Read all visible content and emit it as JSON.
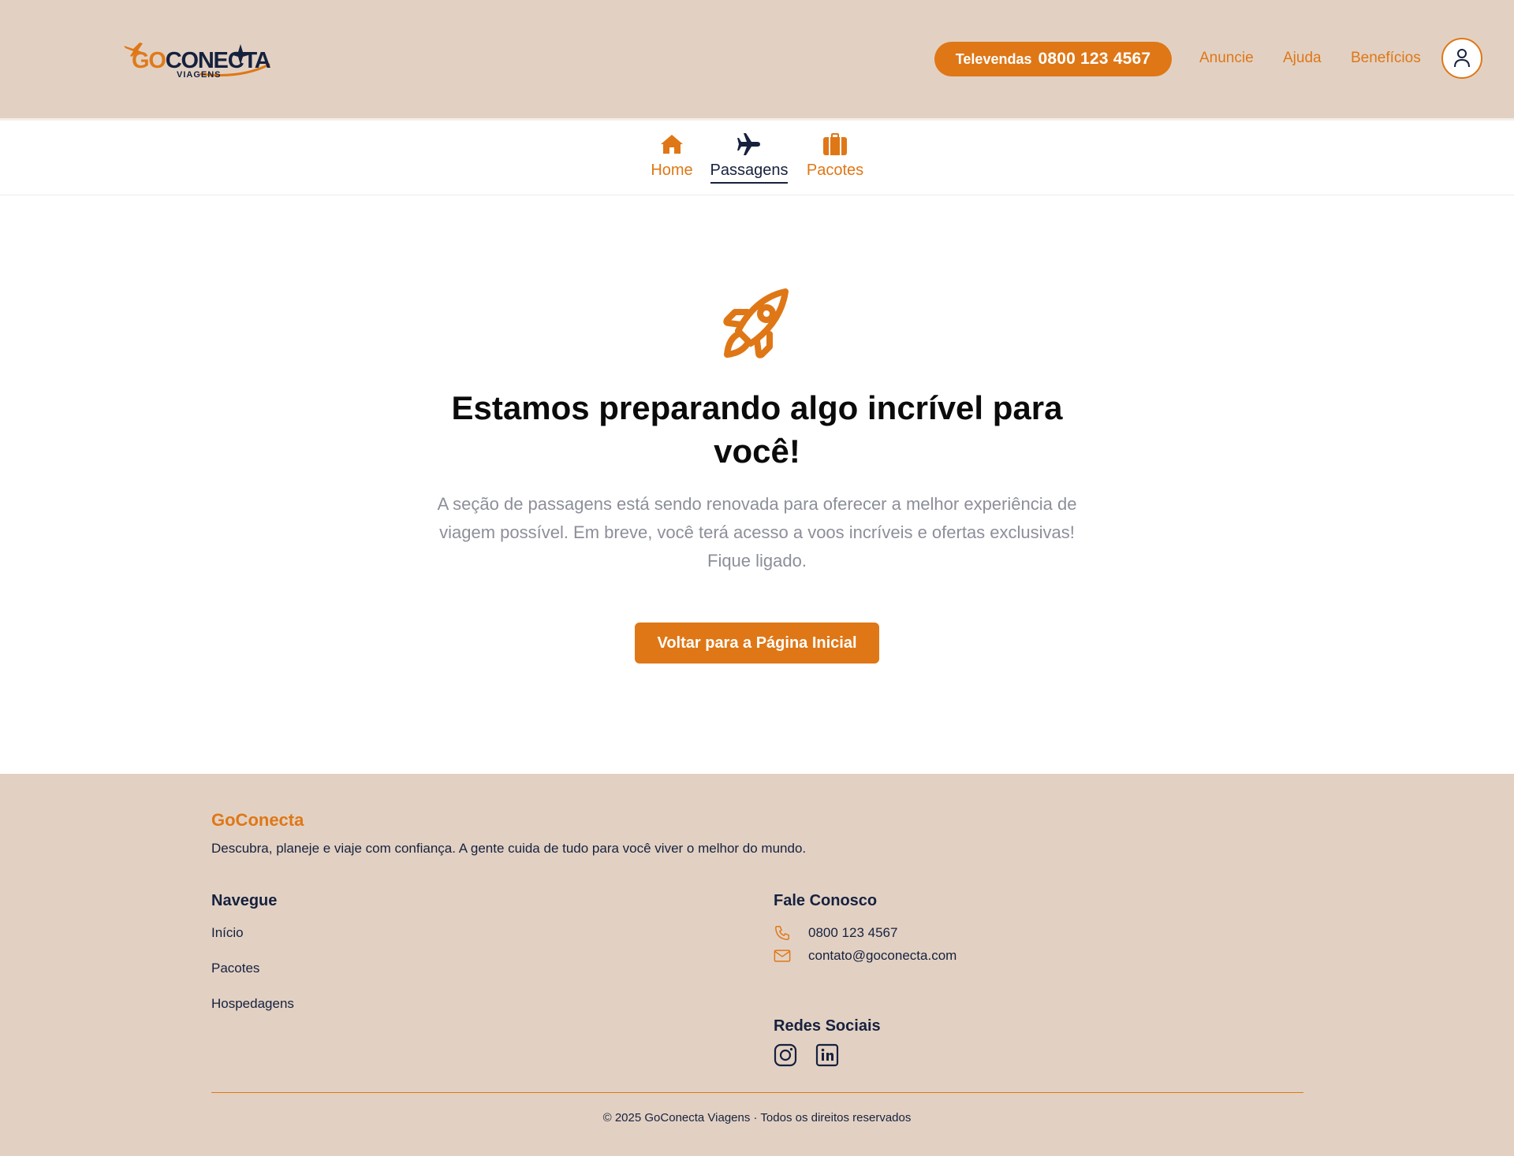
{
  "colors": {
    "accent": "#df7716",
    "navy": "#16213e",
    "header_bg": "#e2d1c3",
    "muted_text": "#8c8f99"
  },
  "header": {
    "logo": {
      "go": "GO",
      "conecta": "CONECTA",
      "sub": "VIAGENS"
    },
    "televendas_label": "Televendas",
    "televendas_number": "0800 123 4567",
    "links": [
      "Anuncie",
      "Ajuda",
      "Benefícios"
    ],
    "avatar_icon": "user-icon"
  },
  "tabs": [
    {
      "label": "Home",
      "icon": "home-icon",
      "active": false
    },
    {
      "label": "Passagens",
      "icon": "airplane-icon",
      "active": true
    },
    {
      "label": "Pacotes",
      "icon": "suitcase-icon",
      "active": false
    }
  ],
  "main": {
    "icon": "rocket-icon",
    "title": "Estamos preparando algo incrível para você!",
    "description": "A seção de passagens está sendo renovada para oferecer a melhor experiência de viagem possível. Em breve, você terá acesso a voos incríveis e ofertas exclusivas! Fique ligado.",
    "button_label": "Voltar para a Página Inicial"
  },
  "footer": {
    "brand": "GoConecta",
    "tagline": "Descubra, planeje e viaje com confiança. A gente cuida de tudo para você viver o melhor do mundo.",
    "nav_heading": "Navegue",
    "nav_links": [
      "Início",
      "Pacotes",
      "Hospedagens"
    ],
    "contact_heading": "Fale Conosco",
    "phone": "0800 123 4567",
    "email": "contato@goconecta.com",
    "social_heading": "Redes Sociais",
    "social_icons": [
      "instagram-icon",
      "linkedin-icon"
    ],
    "copyright": "© 2025 GoConecta Viagens · Todos os direitos reservados"
  }
}
